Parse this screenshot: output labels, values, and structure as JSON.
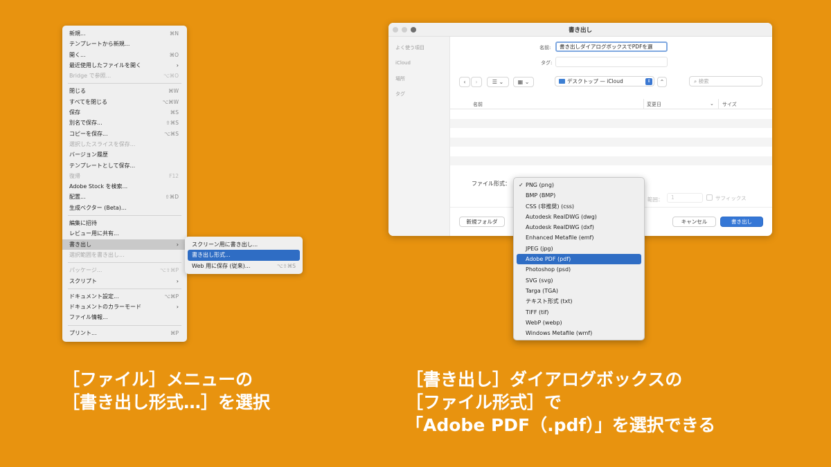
{
  "file_menu": {
    "items": [
      {
        "label": "新規...",
        "shortcut": "⌘N",
        "disabled": false
      },
      {
        "label": "テンプレートから新規...",
        "shortcut": "",
        "disabled": false
      },
      {
        "label": "開く...",
        "shortcut": "⌘O",
        "disabled": false
      },
      {
        "label": "最近使用したファイルを開く",
        "shortcut": "›",
        "disabled": false
      },
      {
        "label": "Bridge で参照...",
        "shortcut": "⌥⌘O",
        "disabled": true
      },
      {
        "label": "閉じる",
        "shortcut": "⌘W",
        "disabled": false
      },
      {
        "label": "すべてを閉じる",
        "shortcut": "⌥⌘W",
        "disabled": false
      },
      {
        "label": "保存",
        "shortcut": "⌘S",
        "disabled": false
      },
      {
        "label": "別名で保存...",
        "shortcut": "⇧⌘S",
        "disabled": false
      },
      {
        "label": "コピーを保存...",
        "shortcut": "⌥⌘S",
        "disabled": false
      },
      {
        "label": "選択したスライスを保存...",
        "shortcut": "",
        "disabled": true
      },
      {
        "label": "バージョン履歴",
        "shortcut": "",
        "disabled": false
      },
      {
        "label": "テンプレートとして保存...",
        "shortcut": "",
        "disabled": false
      },
      {
        "label": "復帰",
        "shortcut": "F12",
        "disabled": true
      },
      {
        "label": "Adobe Stock を検索...",
        "shortcut": "",
        "disabled": false
      },
      {
        "label": "配置...",
        "shortcut": "⇧⌘D",
        "disabled": false
      },
      {
        "label": "生成ベクター (Beta)...",
        "shortcut": "",
        "disabled": false
      },
      {
        "label": "編集に招待",
        "shortcut": "",
        "disabled": false
      },
      {
        "label": "レビュー用に共有...",
        "shortcut": "",
        "disabled": false
      },
      {
        "label": "書き出し",
        "shortcut": "›",
        "disabled": false
      },
      {
        "label": "選択範囲を書き出し...",
        "shortcut": "",
        "disabled": true
      },
      {
        "label": "パッケージ...",
        "shortcut": "⌥⇧⌘P",
        "disabled": true
      },
      {
        "label": "スクリプト",
        "shortcut": "›",
        "disabled": false
      },
      {
        "label": "ドキュメント設定...",
        "shortcut": "⌥⌘P",
        "disabled": false
      },
      {
        "label": "ドキュメントのカラーモード",
        "shortcut": "›",
        "disabled": false
      },
      {
        "label": "ファイル情報...",
        "shortcut": "",
        "disabled": false
      },
      {
        "label": "プリント...",
        "shortcut": "⌘P",
        "disabled": false
      }
    ]
  },
  "export_submenu": {
    "items": [
      {
        "label": "スクリーン用に書き出し...",
        "shortcut": ""
      },
      {
        "label": "書き出し形式...",
        "shortcut": ""
      },
      {
        "label": "Web 用に保存 (従来)...",
        "shortcut": "⌥⇧⌘S"
      }
    ]
  },
  "dialog": {
    "title": "書き出し",
    "sidebar": [
      "よく使う項目",
      "iCloud",
      "場所",
      "タグ"
    ],
    "name_label": "名前:",
    "name_value": "書き出しダイアログボックスでPDFを選",
    "tag_label": "タグ:",
    "nav_back": "‹",
    "nav_forward": "›",
    "view_list": "☰ ⌄",
    "view_grid": "▦ ⌄",
    "location": "デスクトップ — iCloud",
    "location_stepper": "⇕",
    "expand": "⌃",
    "search_placeholder": "検索",
    "search_icon": "⌕",
    "columns": {
      "name": "名前",
      "modified": "変更日",
      "sort_icon": "⌄",
      "size": "サイズ"
    },
    "format_label": "ファイル形式：",
    "range_label": "範囲：",
    "range_value": "1",
    "suffix_label": "サフィックス",
    "new_folder": "新規フォルダ",
    "cancel": "キャンセル",
    "export": "書き出し"
  },
  "format_dropdown": {
    "checked_index": 0,
    "highlight_index": 7,
    "check_mark": "✓",
    "options": [
      "PNG (png)",
      "BMP (BMP)",
      "CSS (非推奨) (css)",
      "Autodesk RealDWG (dwg)",
      "Autodesk RealDWG (dxf)",
      "Enhanced Metafile (emf)",
      "JPEG (jpg)",
      "Adobe PDF (pdf)",
      "Photoshop (psd)",
      "SVG (svg)",
      "Targa (TGA)",
      "テキスト形式 (txt)",
      "TIFF (tif)",
      "WebP (webp)",
      "Windows Metafile (wmf)"
    ]
  },
  "captions": {
    "left": [
      "［ファイル］メニューの",
      "［書き出し形式…］を選択"
    ],
    "right": [
      "［書き出し］ダイアログボックスの",
      "［ファイル形式］で",
      "「Adobe PDF（.pdf）」を選択できる"
    ]
  }
}
